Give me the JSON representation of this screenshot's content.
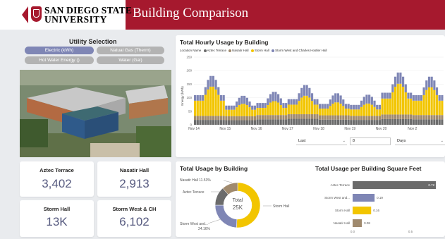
{
  "header": {
    "university_line1": "SAN DIEGO STATE",
    "university_line2": "UNIVERSITY",
    "title": "Building Comparison"
  },
  "utility_selection": {
    "title": "Utility Selection",
    "options": [
      {
        "label": "Electric (kWh)",
        "selected": true
      },
      {
        "label": "Natual Gas (Therm)",
        "selected": false
      },
      {
        "label": "Hot Water Energy ()",
        "selected": false
      },
      {
        "label": "Water (Gal)",
        "selected": false
      }
    ]
  },
  "kpis": [
    {
      "label": "Aztec Terrace",
      "value": "3,402"
    },
    {
      "label": "Nasatir Hall",
      "value": "2,913"
    },
    {
      "label": "Storm Hall",
      "value": "13K"
    },
    {
      "label": "Storm West & CH",
      "value": "6,102"
    }
  ],
  "hourly": {
    "title": "Total Hourly Usage by Building",
    "legend_title": "Location Name",
    "legend": [
      {
        "name": "Aztec Terrace",
        "color": "#6b6b6b"
      },
      {
        "name": "Nasatir Hall",
        "color": "#a08a6e"
      },
      {
        "name": "Storm Hall",
        "color": "#f2c500"
      },
      {
        "name": "Storm West and Charles Hostler Hall",
        "color": "#7f86b5"
      }
    ],
    "ylabel": "Energy (kWh)",
    "yticks": [
      "250",
      "200",
      "150",
      "100",
      "50",
      "0"
    ],
    "xticks": [
      "Nov 14",
      "Nov 15",
      "Nov 16",
      "Nov 17",
      "Nov 18",
      "Nov 19",
      "Nov 20",
      "Nov 2"
    ],
    "filter": {
      "mode": "Last",
      "count": "8",
      "unit": "Days"
    }
  },
  "total_by_building": {
    "title": "Total Usage by Building",
    "center_label": "Total",
    "center_value": "25K",
    "labels": [
      "Nasatir Hall 11.53%",
      "Aztec Terrace",
      "Storm Hall",
      "Storm West and...",
      "24.16%"
    ]
  },
  "per_sqft": {
    "title": "Total Usage per Building Square Feet",
    "xticks": [
      "0.0",
      "0.5"
    ]
  },
  "chart_data": [
    {
      "type": "bar",
      "title": "Total Hourly Usage by Building",
      "ylabel": "Energy (kWh)",
      "ylim": [
        0,
        250
      ],
      "stacked": true,
      "x_range": [
        "Nov 14",
        "Nov 21"
      ],
      "series": [
        {
          "name": "Aztec Terrace",
          "values": [
            18,
            17,
            20,
            22,
            19,
            18,
            21,
            20
          ]
        },
        {
          "name": "Nasatir Hall",
          "values": [
            15,
            15,
            16,
            17,
            16,
            15,
            17,
            16
          ]
        },
        {
          "name": "Storm Hall",
          "values": [
            95,
            40,
            45,
            60,
            42,
            40,
            100,
            90
          ]
        },
        {
          "name": "Storm West and Charles Hostler Hall",
          "values": [
            40,
            30,
            35,
            40,
            34,
            33,
            42,
            40
          ]
        }
      ]
    },
    {
      "type": "pie",
      "title": "Total Usage by Building",
      "categories": [
        "Storm Hall",
        "Storm West and Charles Hostler Hall",
        "Aztec Terrace",
        "Nasatir Hall"
      ],
      "values": [
        50.84,
        24.16,
        13.47,
        11.53
      ],
      "colors": [
        "#f2c500",
        "#7f86b5",
        "#6b6b6b",
        "#a08a6e"
      ]
    },
    {
      "type": "bar",
      "title": "Total Usage per Building Square Feet",
      "categories": [
        "Aztec Terrace",
        "Storm West and...",
        "Storm Hall",
        "Nasatir Hall"
      ],
      "values": [
        0.72,
        0.19,
        0.16,
        0.08
      ],
      "value_labels": [
        "0.72",
        "0.19",
        "0.16",
        "0.08"
      ],
      "colors": [
        "#6b6b6b",
        "#7f86b5",
        "#f2c500",
        "#a08a6e"
      ],
      "xlim": [
        0,
        0.75
      ]
    }
  ]
}
